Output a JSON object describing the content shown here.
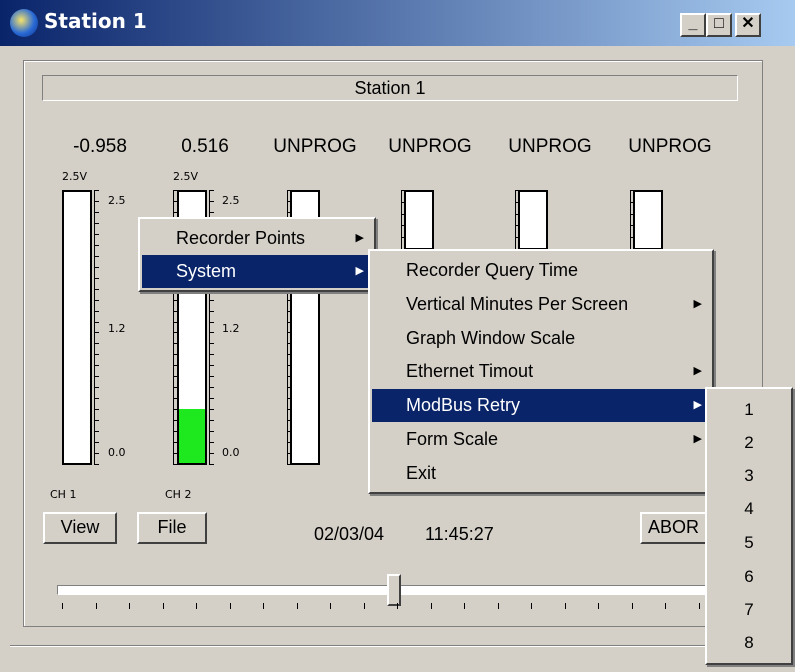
{
  "window": {
    "title": "Station 1",
    "buttons": {
      "minimize": "_",
      "maximize": "□",
      "close": "✕"
    }
  },
  "header": {
    "station_label": "Station 1"
  },
  "channels": [
    {
      "reading": "-0.958",
      "scale_top": "2.5V",
      "max": "2.5",
      "mid": "1.2",
      "min": "0.0",
      "label": "CH 1",
      "level": 0.0
    },
    {
      "reading": "0.516",
      "scale_top": "2.5V",
      "max": "2.5",
      "mid": "1.2",
      "min": "0.0",
      "label": "CH 2",
      "level": 0.2
    },
    {
      "reading": "UNPROG"
    },
    {
      "reading": "UNPROG"
    },
    {
      "reading": "UNPROG"
    },
    {
      "reading": "UNPROG"
    }
  ],
  "toolbar": {
    "view_label": "View",
    "file_label": "File",
    "date": "02/03/04",
    "time": "11:45:27",
    "abort_label": "ABOR"
  },
  "context_menu": {
    "items": [
      {
        "label": "Recorder Points"
      },
      {
        "label": "System"
      }
    ]
  },
  "system_submenu": {
    "items": [
      {
        "label": "Recorder Query Time"
      },
      {
        "label": "Vertical Minutes Per Screen"
      },
      {
        "label": "Graph Window Scale"
      },
      {
        "label": "Ethernet Timout"
      },
      {
        "label": "ModBus Retry"
      },
      {
        "label": "Form Scale"
      },
      {
        "label": "Exit"
      }
    ]
  },
  "modbus_submenu": {
    "items": [
      "1",
      "2",
      "3",
      "4",
      "5",
      "6",
      "7",
      "8"
    ]
  }
}
